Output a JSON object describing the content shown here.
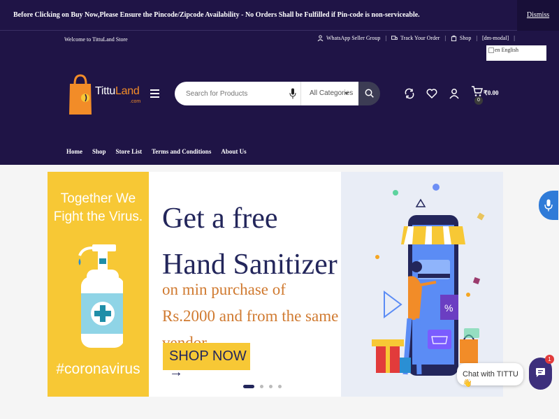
{
  "notice": {
    "message": "Before Clicking on Buy Now,Please Ensure the Pincode/Zipcode Availability - No Orders Shall be Fulfilled if Pin-code is non-serviceable.",
    "dismiss": "Dismiss"
  },
  "topbar": {
    "welcome": "Welcome to TittuLand Store",
    "links": [
      "WhatsApp Seller Group",
      "Track Your Order",
      "Shop",
      "[dm-modal]"
    ],
    "language": {
      "flag_alt": "en",
      "label": "English"
    }
  },
  "logo": {
    "brand_a": "Tittu",
    "brand_b": "Land",
    "suffix": ".com"
  },
  "search": {
    "placeholder": "Search for Products",
    "category": "All Categories"
  },
  "cart": {
    "amount": "₹0.00",
    "count": "0"
  },
  "nav": [
    "Home",
    "Shop",
    "Store List",
    "Terms and Conditions",
    "About Us"
  ],
  "banner": {
    "left_title": "Together We Fight the Virus.",
    "hashtag": "#coronavirus",
    "headline": "Get a free Hand Sanitizer",
    "subline": "on min purchase of Rs.2000 and from the same vendor.",
    "cta": "SHOP NOW",
    "cta_arrow": "→",
    "active_slide": 1,
    "slide_count": 4
  },
  "chat": {
    "label": "Chat with TITTU",
    "emoji": "👋",
    "badge": "1"
  },
  "colors": {
    "header_bg": "#1f1446",
    "accent_yellow": "#f7c835",
    "headline_navy": "#23265b",
    "subline_orange": "#d07a30",
    "brand_orange": "#f28c28"
  }
}
